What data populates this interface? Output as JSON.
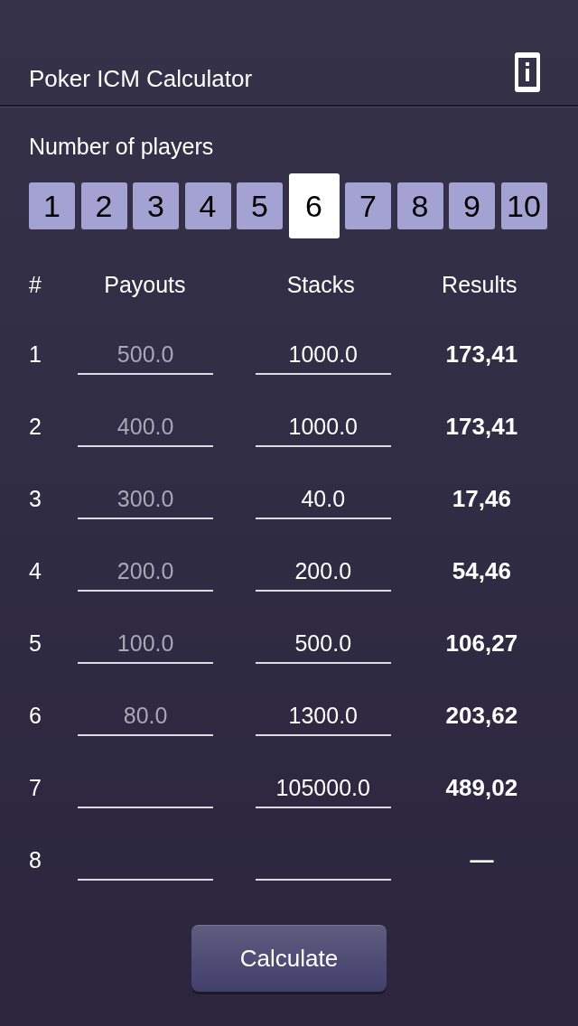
{
  "header": {
    "title": "Poker ICM Calculator"
  },
  "players": {
    "label": "Number of players",
    "options": [
      {
        "label": "1",
        "selected": false
      },
      {
        "label": "2",
        "selected": false
      },
      {
        "label": "3",
        "selected": false
      },
      {
        "label": "4",
        "selected": false
      },
      {
        "label": "5",
        "selected": false
      },
      {
        "label": "6",
        "selected": true
      },
      {
        "label": "7",
        "selected": false
      },
      {
        "label": "8",
        "selected": false
      },
      {
        "label": "9",
        "selected": false
      },
      {
        "label": "10",
        "selected": false
      }
    ]
  },
  "table": {
    "columns": [
      "#",
      "Payouts",
      "Stacks",
      "Results"
    ],
    "rows": [
      {
        "rank": "1",
        "payout": {
          "placeholder": "500.0"
        },
        "stack": {
          "value": "1000.0"
        },
        "result": "173,41"
      },
      {
        "rank": "2",
        "payout": {
          "placeholder": "400.0"
        },
        "stack": {
          "value": "1000.0"
        },
        "result": "173,41"
      },
      {
        "rank": "3",
        "payout": {
          "placeholder": "300.0"
        },
        "stack": {
          "value": "40.0"
        },
        "result": "17,46"
      },
      {
        "rank": "4",
        "payout": {
          "placeholder": "200.0"
        },
        "stack": {
          "value": "200.0"
        },
        "result": "54,46"
      },
      {
        "rank": "5",
        "payout": {
          "placeholder": "100.0"
        },
        "stack": {
          "value": "500.0"
        },
        "result": "106,27"
      },
      {
        "rank": "6",
        "payout": {
          "placeholder": "80.0"
        },
        "stack": {
          "value": "1300.0"
        },
        "result": "203,62"
      },
      {
        "rank": "7",
        "stack": {
          "value": "105000.0"
        },
        "result": "489,02"
      },
      {
        "rank": "8",
        "result": "—"
      }
    ]
  },
  "calculate_button": {
    "label": "Calculate"
  }
}
